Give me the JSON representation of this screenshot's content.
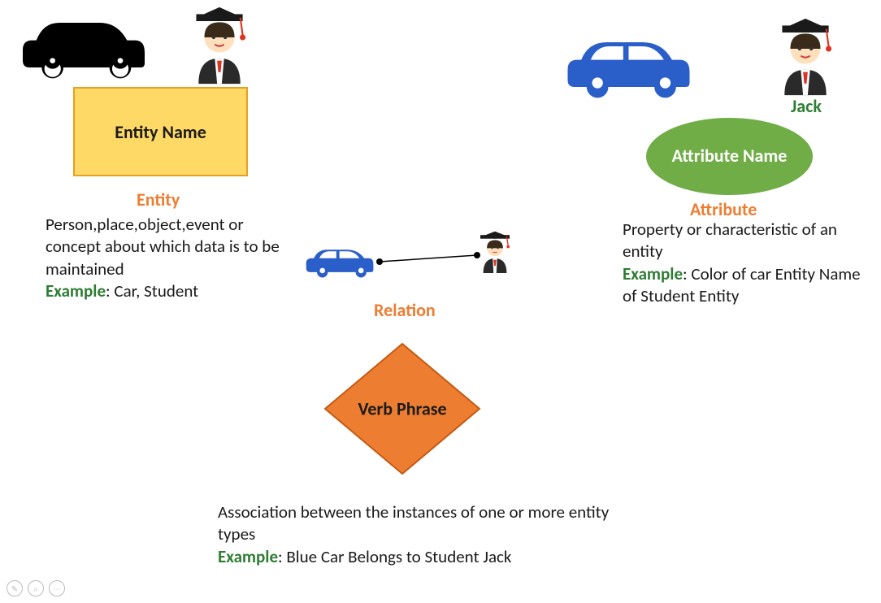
{
  "entity": {
    "shape_label": "Entity Name",
    "heading": "Entity",
    "description": "Person,place,object,event or concept about which data is to be maintained",
    "example_label": "Example",
    "example_text": ": Car, Student"
  },
  "attribute": {
    "shape_label": "Attribute Name",
    "heading": "Attribute",
    "jack_label": "Jack",
    "description": "Property or characteristic of an entity",
    "example_label": "Example",
    "example_text": ": Color of car Entity Name of Student Entity"
  },
  "relation": {
    "shape_label": "Verb Phrase",
    "heading": "Relation",
    "description": "Association between the instances of one or more entity types",
    "example_label": "Example",
    "example_text": ": Blue Car Belongs to Student Jack"
  },
  "icons": {
    "black_car": "black-car",
    "blue_car": "blue-car",
    "student": "student"
  }
}
